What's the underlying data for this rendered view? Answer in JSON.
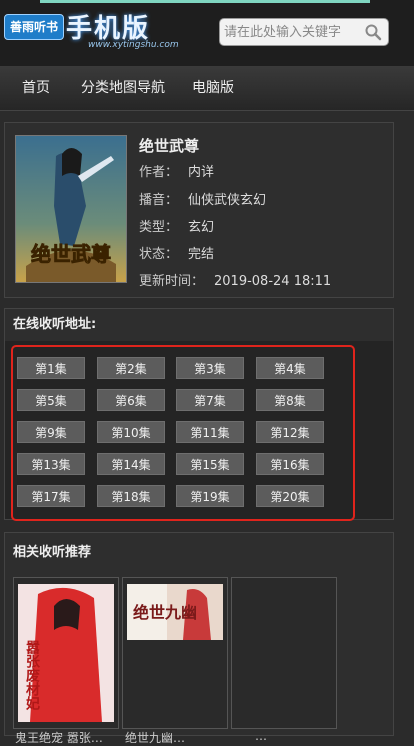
{
  "header": {
    "logo_badge": "善雨听书",
    "logo_title": "手机版",
    "logo_url": "www.xytingshu.com",
    "search_placeholder": "请在此处输入关键字"
  },
  "nav": [
    "首页",
    "分类地图导航",
    "电脑版"
  ],
  "book": {
    "title": "绝世武尊",
    "cover_text": "绝世武尊",
    "author_label": "作者：",
    "author": "内详",
    "narrator_label": "播音：",
    "narrator": "仙侠武侠玄幻",
    "genre_label": "类型：",
    "genre": "玄幻",
    "status_label": "状态：",
    "status": "完结",
    "updated_label": "更新时间：",
    "updated": "2019-08-24 18:11"
  },
  "episodes": {
    "title": "在线收听地址:",
    "items": [
      "第1集",
      "第2集",
      "第3集",
      "第4集",
      "第5集",
      "第6集",
      "第7集",
      "第8集",
      "第9集",
      "第10集",
      "第11集",
      "第12集",
      "第13集",
      "第14集",
      "第15集",
      "第16集",
      "第17集",
      "第18集",
      "第19集",
      "第20集"
    ]
  },
  "related": {
    "title": "相关收听推荐",
    "items": [
      {
        "name": "鬼王绝宠 嚣张…",
        "cover_text": "嚣张废材妃"
      },
      {
        "name": "绝世九幽…",
        "cover_text": "绝世九幽"
      },
      {
        "name": "…"
      }
    ]
  },
  "colors": {
    "highlight_border": "#e0241c",
    "episode_button": "#5c5c5c",
    "background": "#2b2b2b"
  }
}
